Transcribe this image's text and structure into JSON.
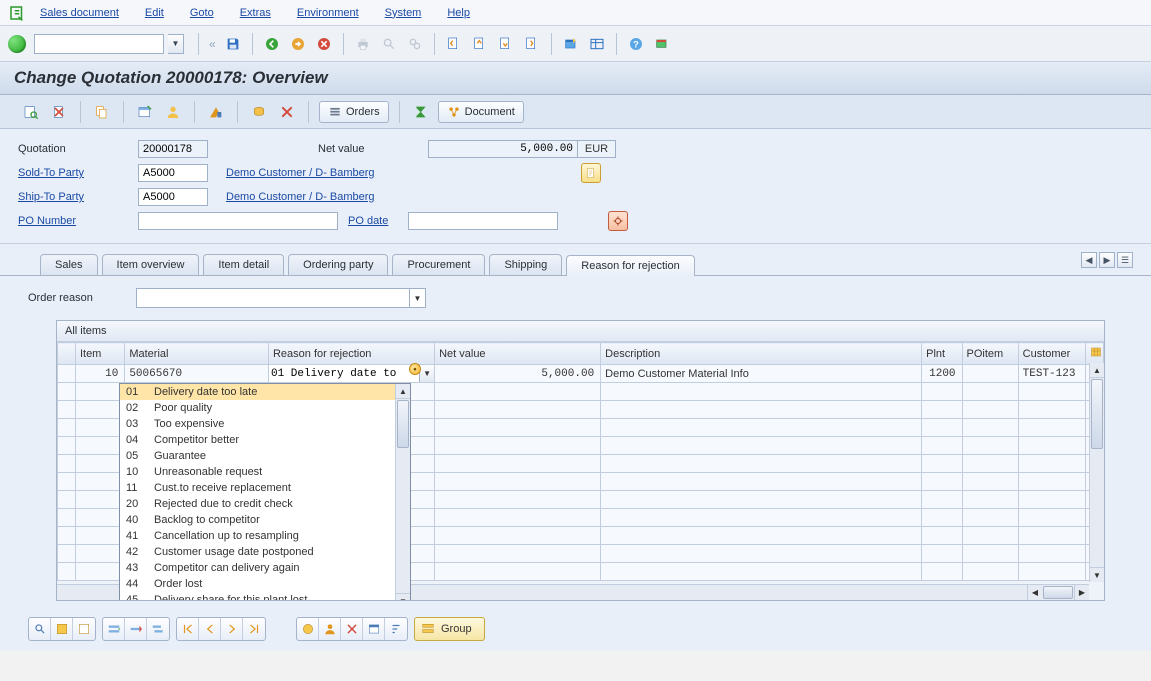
{
  "menu": {
    "items": [
      "Sales document",
      "Edit",
      "Goto",
      "Extras",
      "Environment",
      "System",
      "Help"
    ]
  },
  "title": "Change Quotation 20000178: Overview",
  "app_toolbar": {
    "orders_label": "Orders",
    "document_label": "Document"
  },
  "header": {
    "quotation_label": "Quotation",
    "quotation": "20000178",
    "netvalue_label": "Net value",
    "netvalue": "5,000.00",
    "currency": "EUR",
    "soldto_label": "Sold-To Party",
    "soldto": "A5000",
    "shipto_label": "Ship-To Party",
    "shipto": "A5000",
    "partner_name": "Demo Customer / D- Bamberg",
    "ponum_label": "PO Number",
    "ponum": "",
    "podate_label": "PO date",
    "podate": ""
  },
  "tabs": [
    "Sales",
    "Item overview",
    "Item detail",
    "Ordering party",
    "Procurement",
    "Shipping",
    "Reason for rejection"
  ],
  "active_tab": 6,
  "order_reason_label": "Order reason",
  "grid": {
    "title": "All items",
    "columns": [
      "",
      "Item",
      "Material",
      "Reason for rejection",
      "Net value",
      "Description",
      "Plnt",
      "POitem",
      "Customer",
      ""
    ],
    "row": {
      "item": "10",
      "material": "50065670",
      "reason_code": "01",
      "reason_text": "Delivery date too late",
      "reason_display": "01 Delivery date to",
      "netvalue": "5,000.00",
      "description": "Demo Customer Material Info",
      "plnt": "1200",
      "poitem": "",
      "customer": "TEST-123"
    },
    "reason_options": [
      {
        "code": "01",
        "text": "Delivery date too late"
      },
      {
        "code": "02",
        "text": "Poor quality"
      },
      {
        "code": "03",
        "text": "Too expensive"
      },
      {
        "code": "04",
        "text": "Competitor better"
      },
      {
        "code": "05",
        "text": "Guarantee"
      },
      {
        "code": "10",
        "text": "Unreasonable request"
      },
      {
        "code": "11",
        "text": "Cust.to receive replacement"
      },
      {
        "code": "20",
        "text": "Rejected due to credit check"
      },
      {
        "code": "40",
        "text": "Backlog to competitor"
      },
      {
        "code": "41",
        "text": "Cancellation up to resampling"
      },
      {
        "code": "42",
        "text": "Customer usage date postponed"
      },
      {
        "code": "43",
        "text": "Competitor can delivery again"
      },
      {
        "code": "44",
        "text": "Order lost"
      },
      {
        "code": "45",
        "text": "Delivery share for this plant lost"
      }
    ]
  },
  "group_button": "Group"
}
